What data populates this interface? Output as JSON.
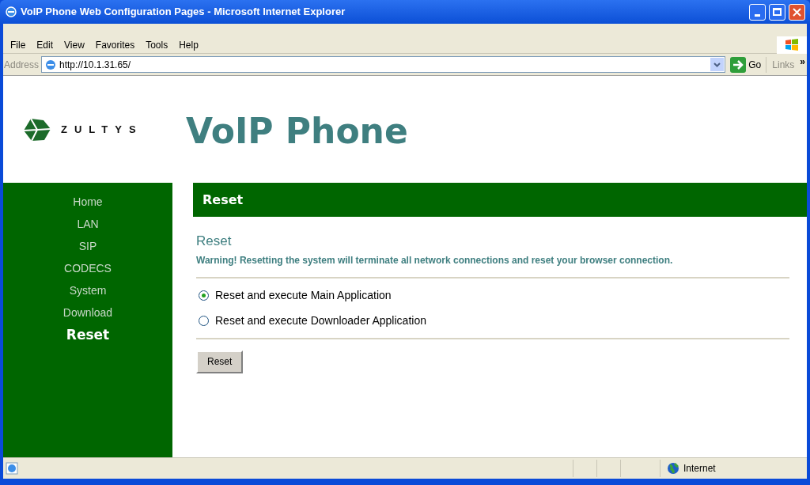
{
  "window": {
    "title": "VoIP Phone Web Configuration Pages - Microsoft Internet Explorer"
  },
  "menu": [
    "File",
    "Edit",
    "View",
    "Favorites",
    "Tools",
    "Help"
  ],
  "address_bar": {
    "label": "Address",
    "value": "http://10.1.31.65/",
    "go": "Go",
    "links": "Links",
    "more": "»"
  },
  "logo": {
    "text": "ZULTYS"
  },
  "page_title": "VoIP Phone",
  "sidebar": {
    "items": [
      {
        "label": "Home",
        "selected": false
      },
      {
        "label": "LAN",
        "selected": false
      },
      {
        "label": "SIP",
        "selected": false
      },
      {
        "label": "CODECS",
        "selected": false
      },
      {
        "label": "System",
        "selected": false
      },
      {
        "label": "Download",
        "selected": false
      },
      {
        "label": "Reset",
        "selected": true
      }
    ]
  },
  "section_bar": "Reset",
  "section_title": "Reset",
  "warning": "Warning! Resetting the system will terminate all network connections and reset your browser connection.",
  "options": [
    {
      "label": "Reset and execute Main Application",
      "selected": true
    },
    {
      "label": "Reset and execute Downloader Application",
      "selected": false
    }
  ],
  "button": "Reset",
  "status_bar": {
    "zone": "Internet"
  }
}
